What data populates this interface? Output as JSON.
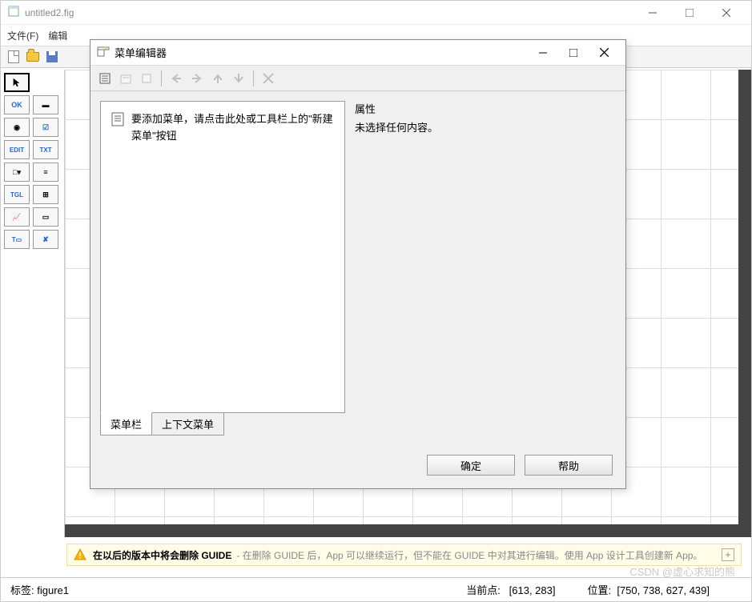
{
  "main_window": {
    "title": "untitled2.fig",
    "menu": {
      "file": "文件(F)",
      "edit": "编辑"
    },
    "palette_labels": {
      "ok": "OK",
      "sldr": "▬",
      "radio": "◉",
      "chk": "☑",
      "edit": "EDIT",
      "txt": "TXT",
      "pop": "□▾",
      "list": "≡",
      "tgl": "TGL",
      "tbl": "⊞",
      "axes": "📈",
      "panel": "▭",
      "bgrp": "T▭",
      "actx": "✘"
    }
  },
  "dialog": {
    "title": "菜单编辑器",
    "hint": "要添加菜单，请点击此处或工具栏上的\"新建菜单\"按钮",
    "tabs": {
      "menubar": "菜单栏",
      "context": "上下文菜单"
    },
    "props_label": "属性",
    "props_empty": "未选择任何内容。",
    "ok": "确定",
    "help": "帮助"
  },
  "warning": {
    "bold": "在以后的版本中将会删除 GUIDE",
    "rest": "- 在删除 GUIDE 后，App 可以继续运行，但不能在 GUIDE 中对其进行编辑。使用 App 设计工具创建新 App。"
  },
  "status": {
    "tag_label": "标签:",
    "tag_value": "figure1",
    "curpt_label": "当前点:",
    "curpt_value": "[613, 283]",
    "pos_label": "位置:",
    "pos_value": "[750, 738, 627, 439]"
  },
  "watermark": "CSDN @虚心求知的熊"
}
